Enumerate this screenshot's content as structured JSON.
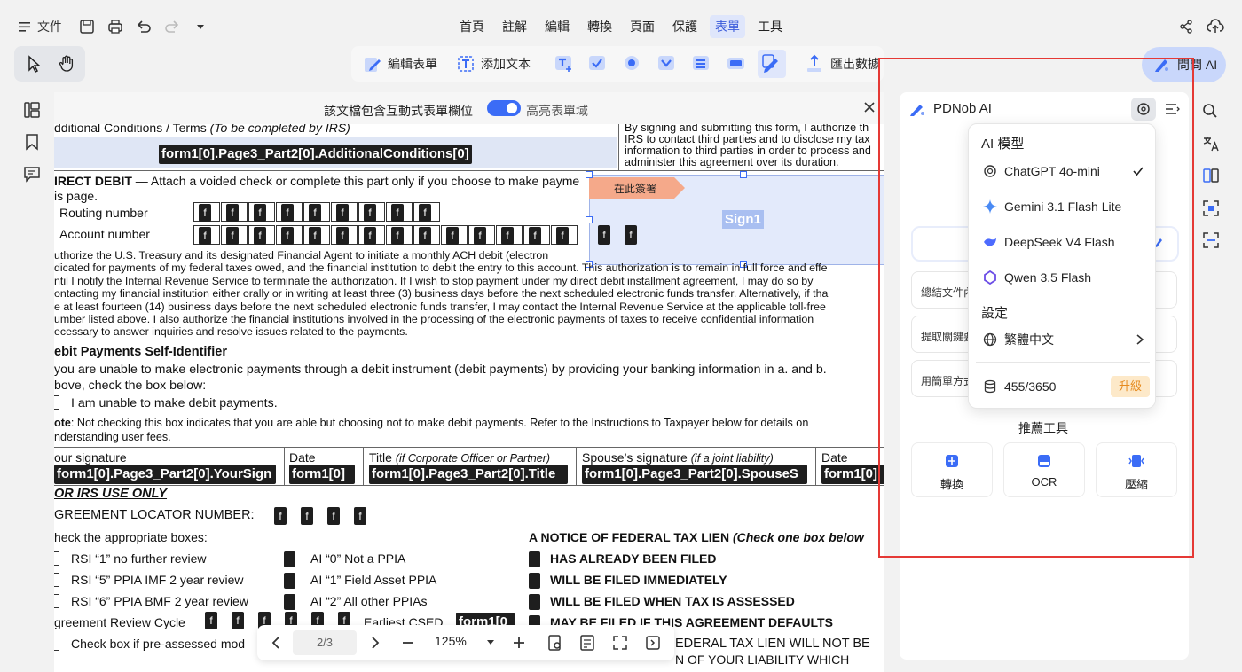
{
  "menubar": {
    "file_label": "文件",
    "tabs": [
      "首頁",
      "註解",
      "編輯",
      "轉換",
      "頁面",
      "保護",
      "表單",
      "工具"
    ]
  },
  "toolbar": {
    "edit_form": "編輯表單",
    "add_text": "添加文本",
    "export_data": "匯出數據",
    "ask_ai": "問問 AI"
  },
  "notice": {
    "text": "該文檔包含互動式表單欄位",
    "toggle_label": "高亮表單域"
  },
  "document": {
    "line1": "dditional Conditions / Terms",
    "line1_italic": "(To be completed by IRS)",
    "field_additional": "form1[0].Page3_Part2[0].AdditionalConditions[0]",
    "right_para": [
      "By signing and submitting this form, I authorize th",
      "IRS to contact third parties and to disclose my tax",
      "information to third parties in order to process and",
      "administer this agreement over its duration."
    ],
    "direct_debit_title": "IRECT DEBIT",
    "direct_debit_text": " — Attach a voided check or complete this part only if you choose to make payme",
    "page_line": "is page.",
    "routing": "Routing number",
    "account": "Account number",
    "box_char": "f",
    "sign_tag": "在此簽署",
    "sign_field": "Sign1",
    "authorize_para": [
      "uthorize the U.S. Treasury and its designated Financial Agent to initiate a monthly ACH debit (electron",
      "dicated for payments of my federal taxes owed, and the financial institution to debit the entry to this account. This authorization is to remain in full force and effe",
      "ntil I notify the Internal Revenue Service to terminate the authorization. If I wish to stop payment under my direct debit installment agreement, I may do so by",
      "ontacting my financial institution either orally or in writing at least three (3) business days before the next scheduled electronic funds transfer. Alternatively, if tha",
      "e at least fourteen (14) business days before the next scheduled electronic funds transfer, I may contact the Internal Revenue Service at the applicable toll-free",
      "umber listed above. I also authorize the financial institutions involved in the processing of the electronic payments of taxes to receive confidential information",
      "ecessary to answer inquiries and resolve issues related to the payments."
    ],
    "debit_title": "ebit Payments Self-Identifier",
    "debit_line1": "you are unable to make electronic payments through a debit instrument (debit payments) by providing your banking information in a. and b.",
    "debit_line2": "bove, check the box below:",
    "unable_line": "I am unable to make debit payments.",
    "note_bold": "ote",
    "note_text": ": Not checking this box indicates that you are able but choosing not to make debit payments. Refer to the Instructions to Taxpayer below for details on",
    "note_line2": "nderstanding user fees.",
    "sig_headers": [
      "our signature",
      "Date",
      "Title",
      "Spouse’s signature",
      "Date"
    ],
    "title_italic": "(if Corporate Officer or Partner)",
    "spouse_italic": "(if a joint liability)",
    "sig_fields": [
      "form1[0].Page3_Part2[0].YourSign",
      "form1[0]",
      "form1[0].Page3_Part2[0].Title",
      "form1[0].Page3_Part2[0].SpouseS",
      "form1[0]"
    ],
    "irs_only": "OR IRS USE ONLY",
    "locator": "GREEMENT LOCATOR NUMBER:",
    "check_boxes": "heck the appropriate boxes:",
    "rows_left": [
      "RSI “1” no further review",
      "RSI “5” PPIA IMF 2 year review",
      "RSI “6” PPIA BMF 2 year review"
    ],
    "rows_mid": [
      "AI “0” Not a PPIA",
      "AI “1” Field Asset PPIA",
      "AI “2” All other PPIAs"
    ],
    "notice_title": "A NOTICE OF FEDERAL TAX LIEN",
    "notice_italic": "(Check one box below",
    "rows_right": [
      "HAS ALREADY BEEN FILED",
      "WILL BE FILED IMMEDIATELY",
      "WILL BE FILED WHEN TAX IS ASSESSED",
      "MAY BE FILED IF THIS AGREEMENT DEFAULTS"
    ],
    "review_cycle": "greement Review Cycle",
    "earliest": "Earliest CSED",
    "earliest_field": "form1[0",
    "preassessed": "Check box if pre-assessed mod",
    "lien_line": "EDERAL TAX LIEN WILL NOT BE",
    "lien_line2": "N OF YOUR LIABILITY WHICH"
  },
  "bottombar": {
    "page": "2/3",
    "zoom": "125%"
  },
  "ai_panel": {
    "title": "PDNob AI",
    "section_model": "AI 模型",
    "models": [
      "ChatGPT 4o-mini",
      "Gemini 3.1 Flash Lite",
      "DeepSeek V4 Flash",
      "Qwen 3.5 Flash"
    ],
    "selected_model": "ChatGPT 4o-mini",
    "section_settings": "設定",
    "language": "繁體中文",
    "credits": "455/3650",
    "upgrade": "升級",
    "chips": [
      "總結文件內",
      "提取關鍵要",
      "用簡單方式"
    ],
    "recommended": "推薦工具",
    "tools": [
      "轉換",
      "OCR",
      "壓縮"
    ]
  },
  "colors": {
    "accent": "#3b6cf6",
    "highlight": "#c9d7fb",
    "red_outline": "#e53935",
    "field_bg": "#1e1e1e",
    "sign_tag": "#f5a98a",
    "upgrade_bg": "#fde9c9"
  }
}
